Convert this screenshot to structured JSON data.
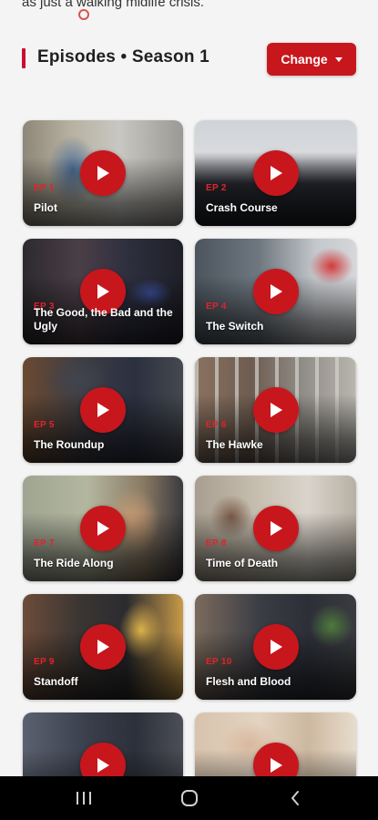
{
  "top_snippet": "as just a walking midlife crisis.",
  "header": {
    "title": "Episodes • Season 1",
    "change_label": "Change"
  },
  "colors": {
    "accent": "#c8161d",
    "ep_number": "#e0242b"
  },
  "episodes": [
    {
      "number": "EP 1",
      "title": "Pilot"
    },
    {
      "number": "EP 2",
      "title": "Crash Course"
    },
    {
      "number": "EP 3",
      "title": "The Good, the Bad and the Ugly"
    },
    {
      "number": "EP 4",
      "title": "The Switch"
    },
    {
      "number": "EP 5",
      "title": "The Roundup"
    },
    {
      "number": "EP 6",
      "title": "The Hawke"
    },
    {
      "number": "EP 7",
      "title": "The Ride Along"
    },
    {
      "number": "EP 8",
      "title": "Time of Death"
    },
    {
      "number": "EP 9",
      "title": "Standoff"
    },
    {
      "number": "EP 10",
      "title": "Flesh and Blood"
    },
    {
      "number": "",
      "title": ""
    },
    {
      "number": "",
      "title": ""
    }
  ],
  "navbar": {
    "icons": [
      "recent-apps-icon",
      "home-icon",
      "back-icon"
    ]
  }
}
